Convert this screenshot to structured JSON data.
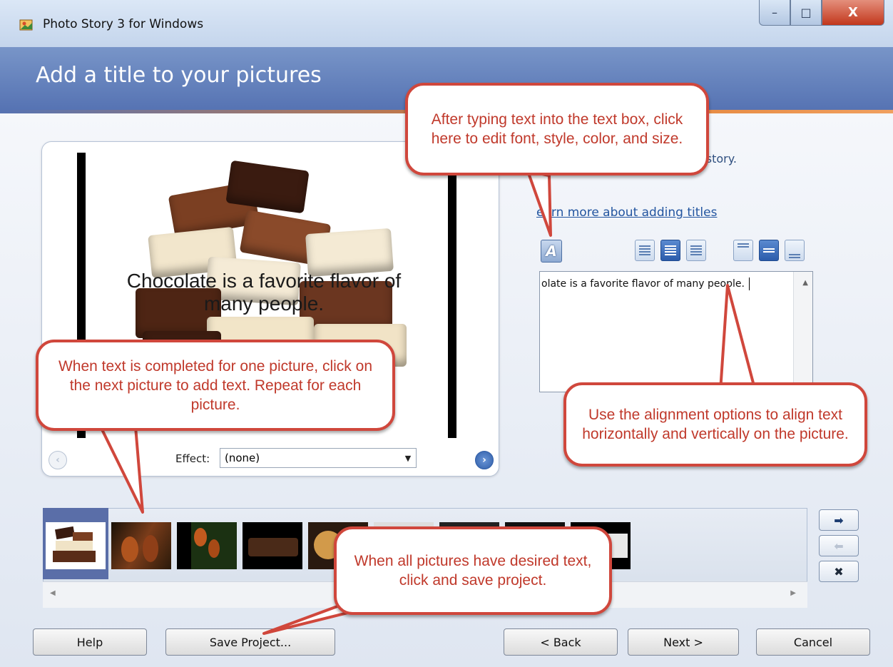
{
  "window": {
    "title": "Photo Story 3 for Windows",
    "icon": "photo-story-icon",
    "controls": {
      "minimize": "–",
      "maximize": "□",
      "close": "X"
    }
  },
  "header": {
    "title": "Add a title to your pictures"
  },
  "preview": {
    "caption": "Chocolate is a favorite flavor of many people.",
    "effect_label": "Effect:",
    "effect_value": "(none)",
    "prev_icon": "‹",
    "next_icon": "›"
  },
  "right_panel": {
    "instruction": "ure to create a title for your story.",
    "learn_link": "earn more about adding titles",
    "font_button_icon": "A",
    "textbox_value": "olate is a favorite flavor of many people.",
    "scroll_up": "▲"
  },
  "filmstrip": {
    "scroll_left": "◀",
    "scroll_right": "▶",
    "move_right": "➡",
    "move_left": "⬅",
    "remove": "✖"
  },
  "buttons": {
    "help": "Help",
    "save_project": "Save Project...",
    "back": "< Back",
    "next": "Next >",
    "cancel": "Cancel"
  },
  "callouts": {
    "font": "After typing text into the text box, click here to edit font, style, color, and size.",
    "alignment": "Use the alignment options to align text horizontally and vertically on the picture.",
    "next_picture": "When text is completed for one picture, click on the next picture to add text. Repeat for each picture.",
    "save": "When all pictures have desired text, click and save project."
  },
  "colors": {
    "header": "#5673b3",
    "accent": "#e07a2c",
    "callout_border": "#d0473c",
    "callout_text": "#c0392b",
    "link": "#2355a0"
  }
}
